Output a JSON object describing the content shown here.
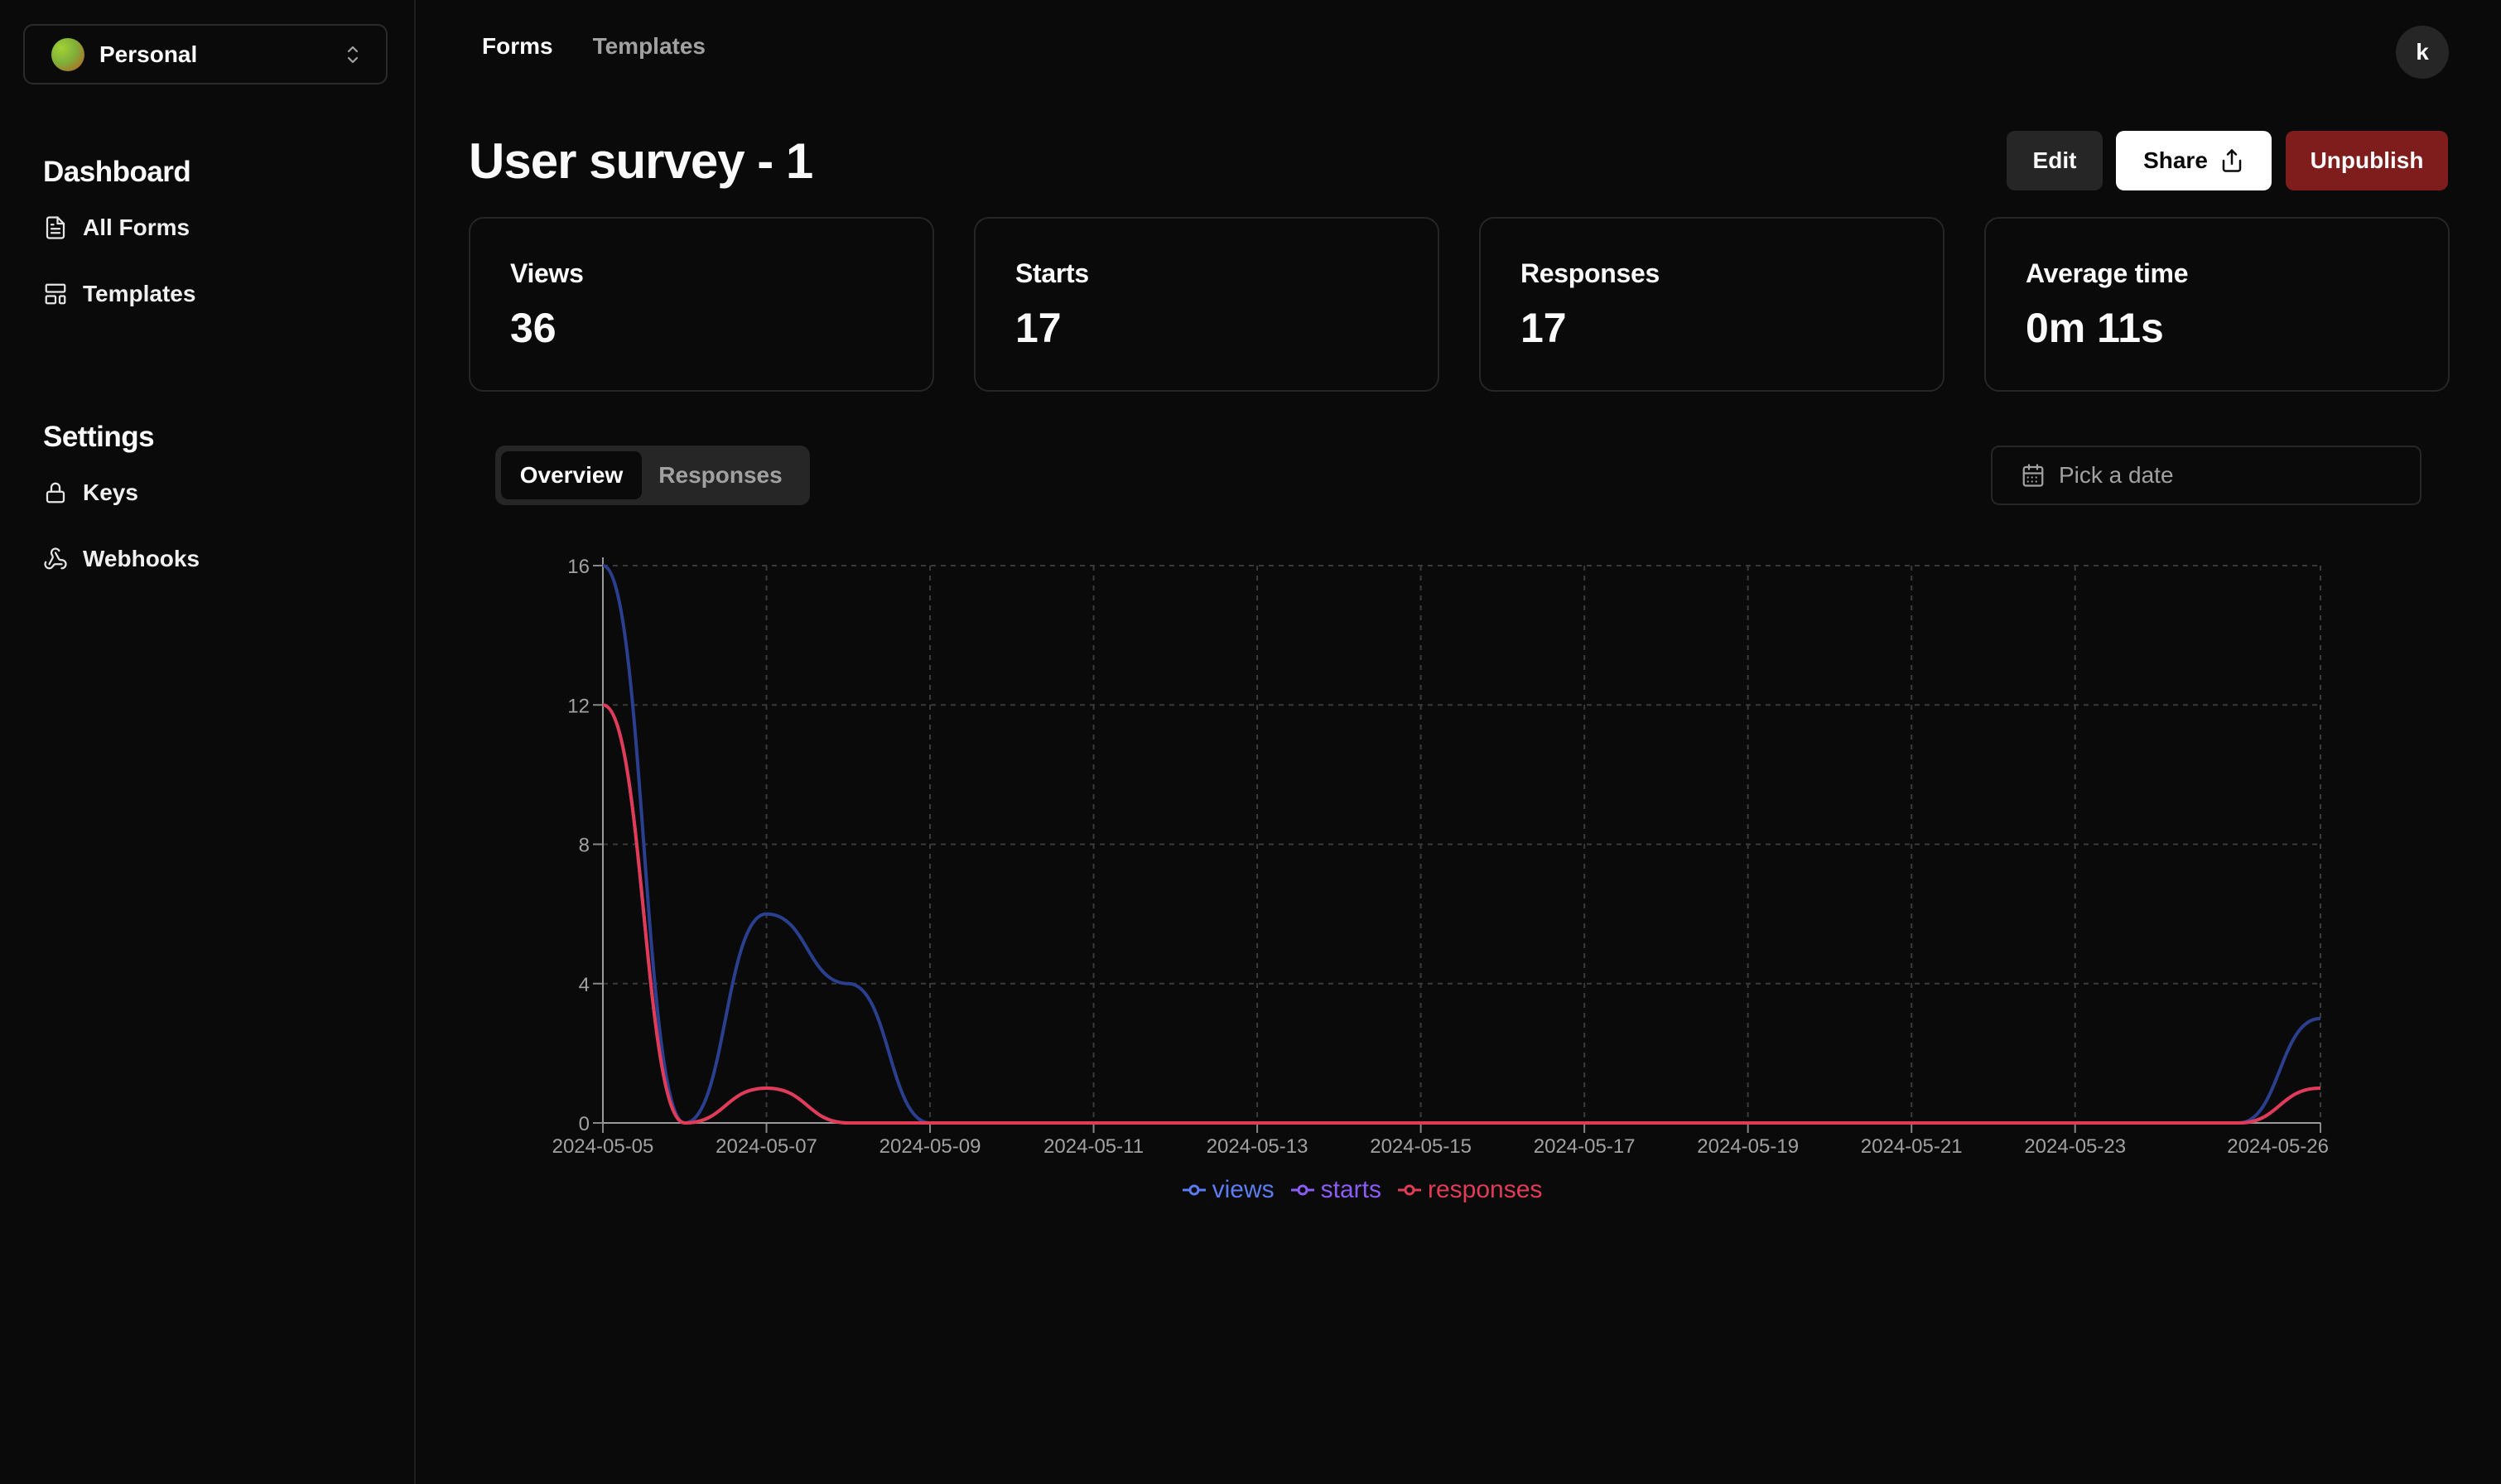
{
  "workspace": {
    "name": "Personal"
  },
  "sidebar": {
    "dashboard_title": "Dashboard",
    "dashboard_items": [
      {
        "label": "All Forms",
        "icon": "document-icon"
      },
      {
        "label": "Templates",
        "icon": "template-icon"
      }
    ],
    "settings_title": "Settings",
    "settings_items": [
      {
        "label": "Keys",
        "icon": "lock-icon"
      },
      {
        "label": "Webhooks",
        "icon": "webhook-icon"
      }
    ]
  },
  "topnav": {
    "forms": "Forms",
    "templates": "Templates"
  },
  "user": {
    "initial": "k"
  },
  "page": {
    "title": "User survey - 1",
    "edit_label": "Edit",
    "share_label": "Share",
    "unpublish_label": "Unpublish"
  },
  "stats": [
    {
      "label": "Views",
      "value": "36"
    },
    {
      "label": "Starts",
      "value": "17"
    },
    {
      "label": "Responses",
      "value": "17"
    },
    {
      "label": "Average time",
      "value": "0m 11s"
    }
  ],
  "tabs": {
    "overview": "Overview",
    "responses": "Responses"
  },
  "date_picker": {
    "placeholder": "Pick a date"
  },
  "colors": {
    "views": "#2b3f8f",
    "starts": "#6b3fd6",
    "responses": "#e23b55",
    "unpublish": "#7f1d1d"
  },
  "chart_data": {
    "type": "line",
    "x": [
      "2024-05-05",
      "2024-05-06",
      "2024-05-07",
      "2024-05-08",
      "2024-05-09",
      "2024-05-10",
      "2024-05-11",
      "2024-05-12",
      "2024-05-13",
      "2024-05-14",
      "2024-05-15",
      "2024-05-16",
      "2024-05-17",
      "2024-05-18",
      "2024-05-19",
      "2024-05-20",
      "2024-05-21",
      "2024-05-22",
      "2024-05-23",
      "2024-05-24",
      "2024-05-25",
      "2024-05-26"
    ],
    "x_tick_labels": [
      "2024-05-05",
      "2024-05-07",
      "2024-05-09",
      "2024-05-11",
      "2024-05-13",
      "2024-05-15",
      "2024-05-17",
      "2024-05-19",
      "2024-05-21",
      "2024-05-23",
      "2024-05-26"
    ],
    "series": [
      {
        "name": "views",
        "values": [
          16,
          0,
          6,
          4,
          0,
          0,
          0,
          0,
          0,
          0,
          0,
          0,
          0,
          0,
          0,
          0,
          0,
          0,
          0,
          0,
          0,
          3
        ]
      },
      {
        "name": "starts",
        "values": [
          12,
          0,
          1,
          0,
          0,
          0,
          0,
          0,
          0,
          0,
          0,
          0,
          0,
          0,
          0,
          0,
          0,
          0,
          0,
          0,
          0,
          1
        ]
      },
      {
        "name": "responses",
        "values": [
          12,
          0,
          1,
          0,
          0,
          0,
          0,
          0,
          0,
          0,
          0,
          0,
          0,
          0,
          0,
          0,
          0,
          0,
          0,
          0,
          0,
          1
        ]
      }
    ],
    "y_ticks": [
      "0",
      "4",
      "8",
      "12",
      "16"
    ],
    "ylim": [
      0,
      16
    ],
    "grid": true,
    "legend": "bottom-center"
  }
}
